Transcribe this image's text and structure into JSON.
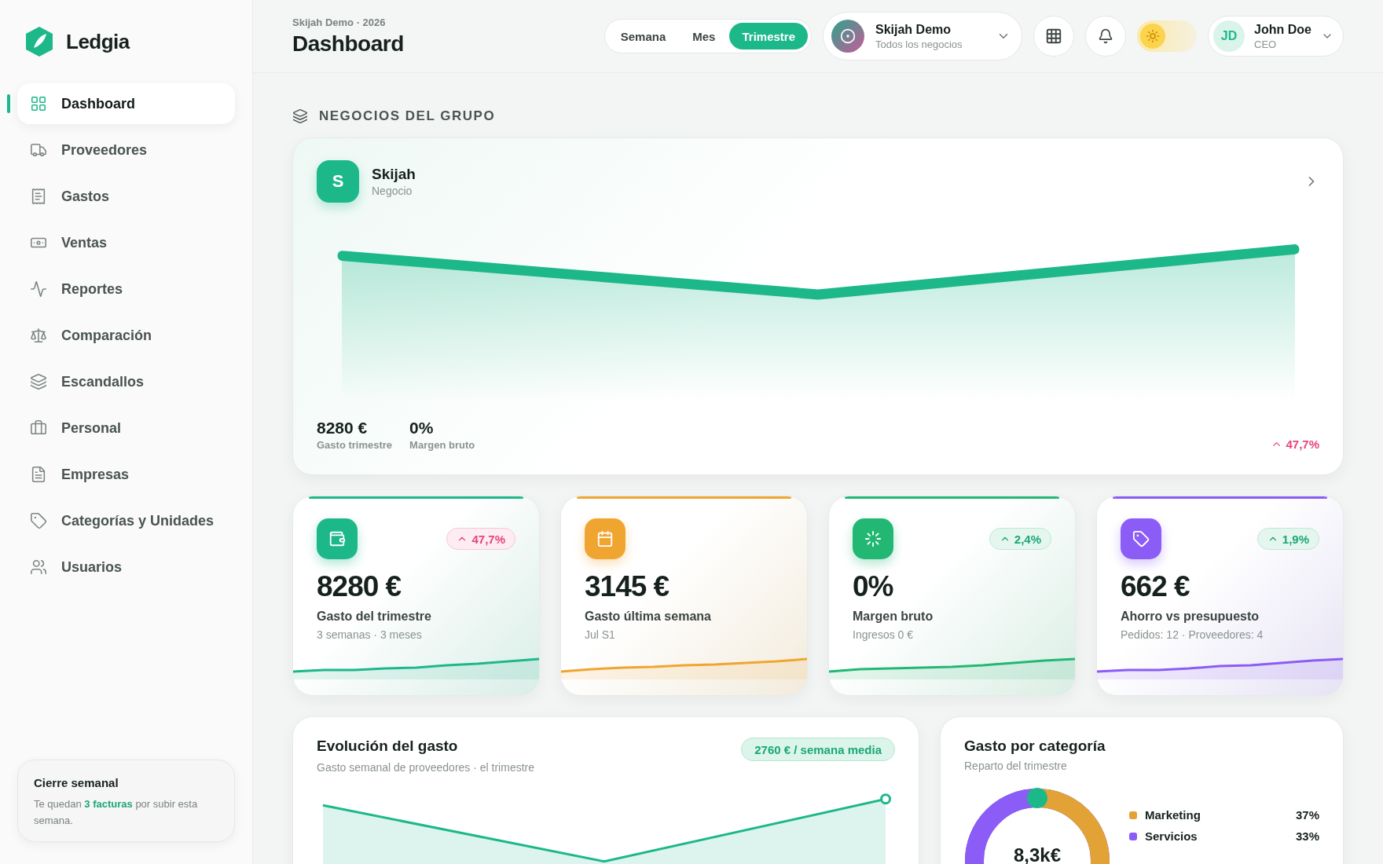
{
  "brand": {
    "name": "Ledgia"
  },
  "sidebar": {
    "items": [
      {
        "label": "Dashboard",
        "selected": true
      },
      {
        "label": "Proveedores",
        "selected": false
      },
      {
        "label": "Gastos",
        "selected": false
      },
      {
        "label": "Ventas",
        "selected": false
      },
      {
        "label": "Reportes",
        "selected": false
      },
      {
        "label": "Comparación",
        "selected": false
      },
      {
        "label": "Escandallos",
        "selected": false
      },
      {
        "label": "Personal",
        "selected": false
      },
      {
        "label": "Empresas",
        "selected": false
      },
      {
        "label": "Categorías y Unidades",
        "selected": false
      },
      {
        "label": "Usuarios",
        "selected": false
      }
    ]
  },
  "sidebar_note": {
    "title": "Cierre semanal",
    "text": "Te quedan **3 facturas** por subir esta semana."
  },
  "header": {
    "subtitle": "Skijah Demo · 2026",
    "title": "Dashboard",
    "periods": [
      {
        "label": "Semana",
        "selected": false
      },
      {
        "label": "Mes",
        "selected": false
      },
      {
        "label": "Trimestre",
        "selected": true
      }
    ],
    "business": {
      "name": "Skijah Demo",
      "scope": "Todos los negocios"
    },
    "dark_mode": false,
    "user": {
      "initials": "JD",
      "name": "John Doe",
      "role": "CEO"
    }
  },
  "group": {
    "title": "NEGOCIOS DEL GRUPO",
    "business": {
      "initial": "S",
      "name": "Skijah",
      "type": "Negocio",
      "stats": [
        {
          "value": "8280 €",
          "label": "Gasto trimestre"
        },
        {
          "value": "0%",
          "label": "Margen bruto"
        }
      ],
      "trend": {
        "value": "47,7%",
        "negative": true
      }
    }
  },
  "kpis": [
    {
      "value": "8280 €",
      "label": "Gasto del trimestre",
      "detail": "3 semanas · 3 meses",
      "color": "#1db88a",
      "trend": {
        "value": "47,7%",
        "negative": true
      }
    },
    {
      "value": "3145 €",
      "label": "Gasto última semana",
      "detail": "Jul S1",
      "color": "#f0a530"
    },
    {
      "value": "0%",
      "label": "Margen bruto",
      "detail": "Ingresos 0 €",
      "color": "#22b874",
      "trend": {
        "value": "2,4%",
        "negative": false
      }
    },
    {
      "value": "662 €",
      "label": "Ahorro vs presupuesto",
      "detail": "Pedidos: 12 · Proveedores: 4",
      "color": "#8b5cf6",
      "trend": {
        "value": "1,9%",
        "negative": false
      }
    }
  ],
  "evolution": {
    "title": "Evolución del gasto",
    "subtitle": "Gasto semanal de proveedores · el trimestre",
    "badge": "2760 € / semana media"
  },
  "categories": {
    "title": "Gasto por categoría",
    "subtitle": "Reparto del trimestre",
    "total": "8,3k€",
    "items": [
      {
        "name": "Marketing",
        "share": "37%",
        "color": "#e3a236"
      },
      {
        "name": "Servicios",
        "share": "33%",
        "color": "#8b5cf6"
      }
    ]
  }
}
